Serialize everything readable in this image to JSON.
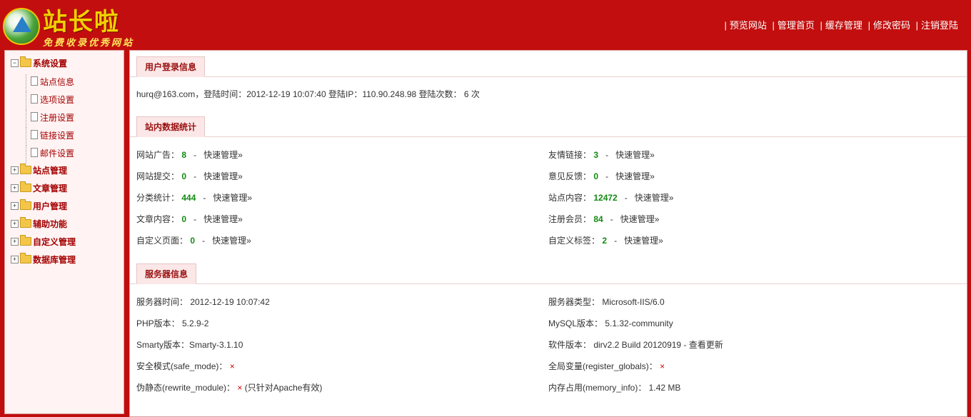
{
  "header": {
    "logo_title": "站长啦",
    "logo_sub": "免费收录优秀网站",
    "nav": [
      "预览网站",
      "管理首页",
      "缓存管理",
      "修改密码",
      "注销登陆"
    ]
  },
  "sidebar": {
    "groups": [
      {
        "label": "系统设置",
        "expanded": true,
        "items": [
          "站点信息",
          "选项设置",
          "注册设置",
          "链接设置",
          "邮件设置"
        ]
      },
      {
        "label": "站点管理",
        "expanded": false
      },
      {
        "label": "文章管理",
        "expanded": false
      },
      {
        "label": "用户管理",
        "expanded": false
      },
      {
        "label": "辅助功能",
        "expanded": false
      },
      {
        "label": "自定义管理",
        "expanded": false
      },
      {
        "label": "数据库管理",
        "expanded": false
      }
    ]
  },
  "login": {
    "title": "用户登录信息",
    "text": "hurq@163.com，登陆时间：2012-12-19 10:07:40    登陆IP：110.90.248.98    登陆次数： 6 次"
  },
  "stats": {
    "title": "站内数据统计",
    "quick": "快速管理»",
    "dash": "-",
    "left": [
      {
        "label": "网站广告：",
        "value": "8"
      },
      {
        "label": "网站提交：",
        "value": "0"
      },
      {
        "label": "分类统计：",
        "value": "444"
      },
      {
        "label": "文章内容：",
        "value": "0"
      },
      {
        "label": "自定义页面：",
        "value": "0"
      }
    ],
    "right": [
      {
        "label": "友情链接：",
        "value": "3"
      },
      {
        "label": "意见反馈：",
        "value": "0"
      },
      {
        "label": "站点内容：",
        "value": "12472"
      },
      {
        "label": "注册会员：",
        "value": "84"
      },
      {
        "label": "自定义标签：",
        "value": "2"
      }
    ]
  },
  "server": {
    "title": "服务器信息",
    "left": [
      "服务器时间： 2012-12-19   10:07:42",
      "PHP版本： 5.2.9-2",
      "Smarty版本：Smarty-3.1.10",
      "安全模式(safe_mode)：",
      "伪静态(rewrite_module)："
    ],
    "safe_mode_mark": "×",
    "rewrite_mark": "×",
    "rewrite_note": " (只针对Apache有效)",
    "right": [
      "服务器类型： Microsoft-IIS/6.0",
      "MySQL版本： 5.1.32-community",
      "软件版本： dirv2.2 Build 20120919 - 查看更新",
      "全局变量(register_globals)：",
      "内存占用(memory_info)： 1.42 MB"
    ],
    "globals_mark": "×"
  }
}
